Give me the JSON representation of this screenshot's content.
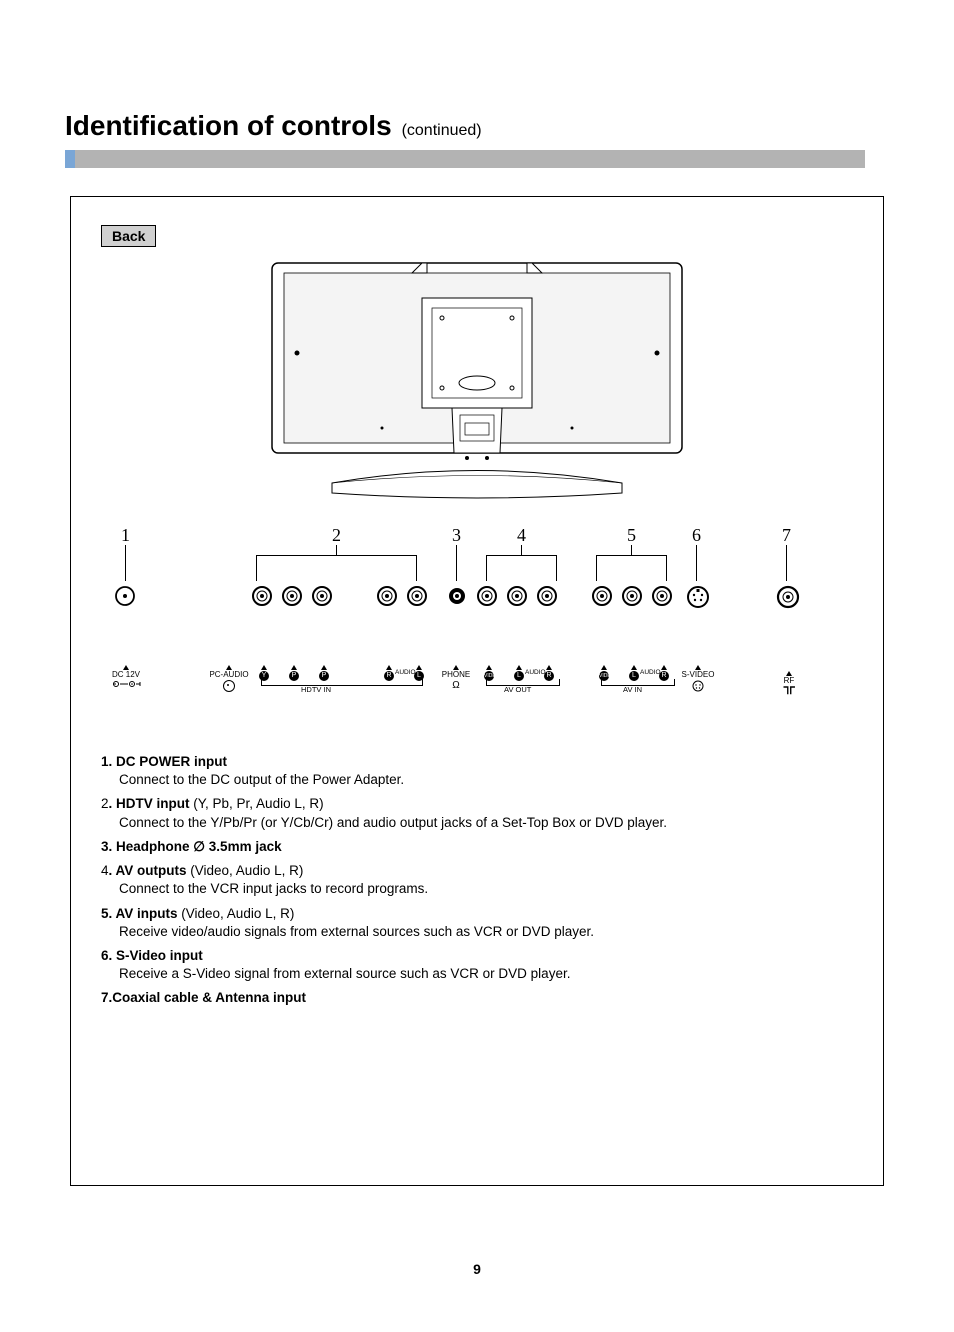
{
  "title": {
    "main": "Identification of controls",
    "cont": "(continued)"
  },
  "section_label": "Back",
  "callouts": [
    "1",
    "2",
    "3",
    "4",
    "5",
    "6",
    "7"
  ],
  "port_labels": {
    "dc": "DC 12V",
    "pcaudio": "PC-AUDIO",
    "y": "Y",
    "pb": "P",
    "pr": "P",
    "hdtv_group": "HDTV IN",
    "r1": "R",
    "audio1": "AUDIO",
    "l1": "L",
    "phone": "PHONE",
    "video1": "VIDEO",
    "l2": "L",
    "audio2": "AUDIO",
    "r2": "R",
    "avout_group": "AV OUT",
    "video2": "VIDEO",
    "l3": "L",
    "audio3": "AUDIO",
    "r3": "R",
    "avin_group": "AV IN",
    "svideo": "S-VIDEO",
    "rf": "RF"
  },
  "descriptions": [
    {
      "num": "1.",
      "title": "DC POWER input",
      "extra": "",
      "sub": "Connect to the DC output of the Power Adapter."
    },
    {
      "num": "2",
      "title": ". HDTV input",
      "extra": " (Y, Pb, Pr, Audio L, R)",
      "sub": "Connect to the Y/Pb/Pr (or Y/Cb/Cr) and audio output jacks of a Set-Top Box or DVD player."
    },
    {
      "num": "3.",
      "title": "Headphone ∅ 3.5mm jack",
      "extra": "",
      "sub": ""
    },
    {
      "num": "4",
      "title": ". AV outputs",
      "extra": " (Video, Audio L, R)",
      "sub": "Connect to the VCR input jacks to record programs."
    },
    {
      "num": "5.",
      "title": "AV inputs",
      "extra": " (Video, Audio L, R)",
      "sub": "Receive video/audio signals from external sources such as VCR or DVD player."
    },
    {
      "num": "6.",
      "title": "S-Video input",
      "extra": "",
      "sub": "Receive a S-Video signal from external source such as VCR or DVD player."
    },
    {
      "num": "7.",
      "title": "Coaxial cable & Antenna input",
      "extra": "",
      "sub": ""
    }
  ],
  "page_number": "9"
}
